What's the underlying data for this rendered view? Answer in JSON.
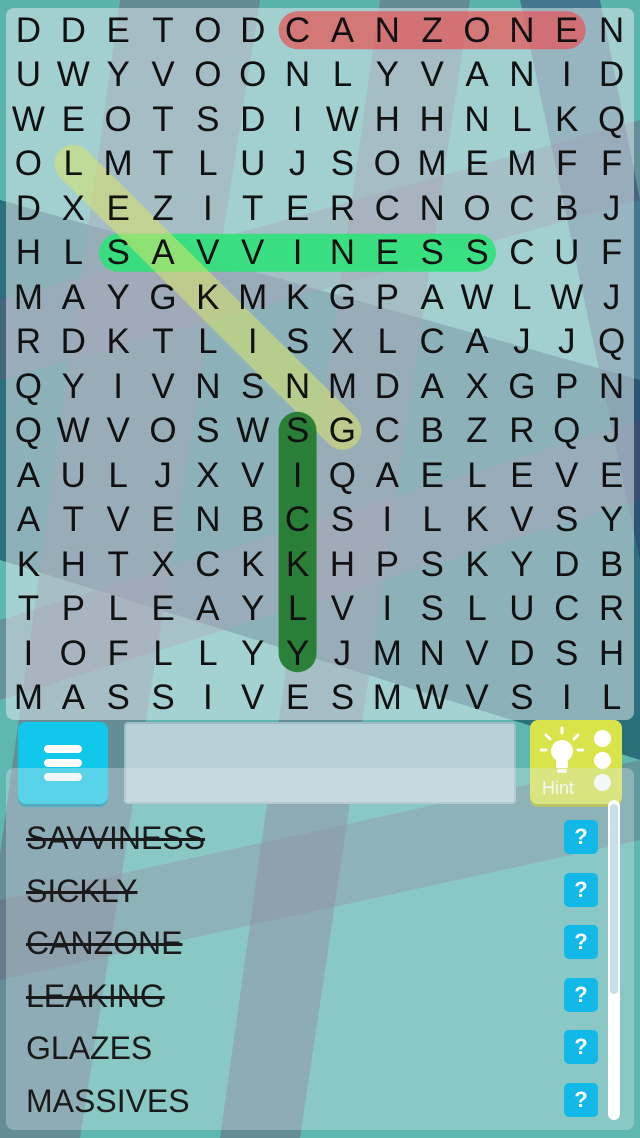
{
  "grid": [
    "DDETODCANZONEN",
    "UWYVOONLYVANID",
    "WEOTSDIWHHNLKQ",
    "OLMTLUJSOMEMFF",
    "DXEZITERCNOCBJ",
    "HLSAVVINESSCUF",
    "MAYGKMKGPAWLWJ",
    "RDKTLISXLCAJJQ",
    "QYIVNSNMDAXGPN",
    "QWVOSWSGCBZRQJ",
    "AULJXVIQAELEVE",
    "ATVENBCSILKVSY",
    "KHTXCKKHPSKYDB",
    "TPLEAYLVISLUCR",
    "IOFLLYYJMNVDSH",
    "MASSIVESMWVSIL"
  ],
  "highlights": [
    {
      "word": "CANZONE",
      "start": [
        0,
        6
      ],
      "end": [
        0,
        12
      ],
      "color": "#e35a5a",
      "opacity": 0.75
    },
    {
      "word": "SAVVINESS",
      "start": [
        5,
        2
      ],
      "end": [
        5,
        10
      ],
      "color": "#2ee27a",
      "opacity": 0.9
    },
    {
      "word": "LEAKING",
      "start": [
        3,
        1
      ],
      "end": [
        9,
        7
      ],
      "color": "#d8e46a",
      "opacity": 0.55
    },
    {
      "word": "SICKLY",
      "start": [
        9,
        6
      ],
      "end": [
        14,
        6
      ],
      "color": "#1e7a2a",
      "opacity": 0.9
    }
  ],
  "controls": {
    "hint_label": "Hint",
    "hints_remaining": 3
  },
  "words": [
    {
      "text": "SAVVINESS",
      "found": true
    },
    {
      "text": "SICKLY",
      "found": true
    },
    {
      "text": "CANZONE",
      "found": true
    },
    {
      "text": "LEAKING",
      "found": true
    },
    {
      "text": "GLAZES",
      "found": false
    },
    {
      "text": "MASSIVES",
      "found": false
    }
  ],
  "hint_icon_text": "?",
  "colors": {
    "menu_button": "#12c8ea",
    "hint_button": "#d9e34a",
    "question_button": "#12b8e8"
  }
}
